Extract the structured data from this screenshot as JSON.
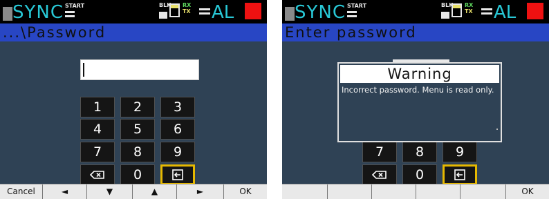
{
  "status": {
    "sync": "SYNC",
    "start": "START",
    "blk": "BLK",
    "rx": "RX",
    "tx": "TX",
    "al": "AL"
  },
  "screen1": {
    "title": "...\\Password",
    "password_value": "",
    "keys": [
      "1",
      "2",
      "3",
      "4",
      "5",
      "6",
      "7",
      "8",
      "9",
      "0"
    ],
    "softkeys": [
      "Cancel",
      "◄",
      "▼",
      "▲",
      "►",
      "OK"
    ]
  },
  "screen2": {
    "title": "Enter password",
    "dialog_title": "Warning",
    "dialog_message": "Incorrect password. Menu is read only.",
    "keys": [
      "7",
      "8",
      "9",
      "0"
    ],
    "softkeys": [
      "",
      "",
      "",
      "",
      "",
      "OK"
    ]
  },
  "colors": {
    "screen_bg": "#2f4255",
    "title_bar": "#2846c4",
    "accent_cyan": "#28c8d6",
    "alarm_red": "#ee1111",
    "selected_key_border": "#e6b800"
  },
  "icons": {
    "backspace": "backspace-icon",
    "enter": "enter-icon"
  }
}
